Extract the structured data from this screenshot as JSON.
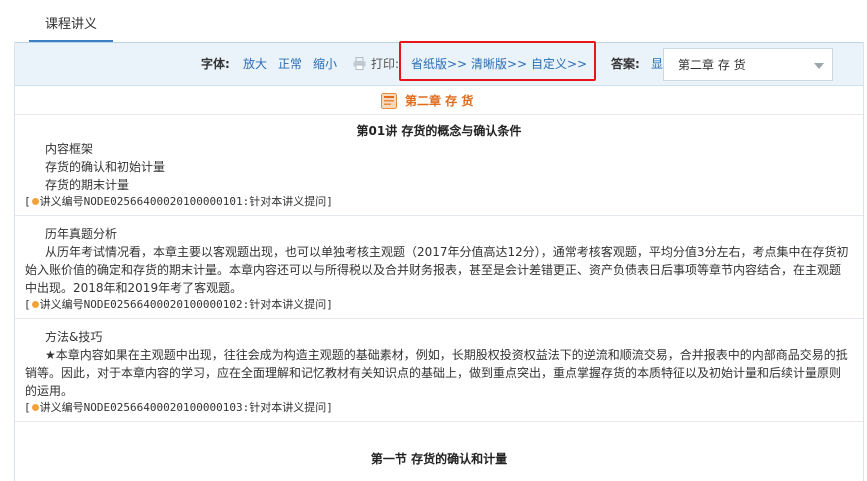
{
  "tabs": [
    {
      "label": "课程讲义"
    }
  ],
  "toolbar": {
    "font_label": "字体:",
    "font_options": [
      "放大",
      "正常",
      "缩小"
    ],
    "print_label": "打印:",
    "print_options": [
      "省纸版>>",
      "清晰版>>",
      "自定义>>"
    ],
    "answer_label": "答案:",
    "answer_option": "显",
    "chapter_select": "第二章  存  货"
  },
  "chapter_header": "第二章  存  货",
  "sections": [
    {
      "heading": "第01讲  存货的概念与确认条件",
      "lines": [
        "内容框架",
        "存货的确认和初始计量",
        "存货的期末计量"
      ],
      "ref": "讲义编号NODE02566400020100000101:针对本讲义提问"
    },
    {
      "title": "历年真题分析",
      "paragraph": "从历年考试情况看，本章主要以客观题出现，也可以单独考核主观题（2017年分值高达12分），通常考核客观题，平均分值3分左右，考点集中在存货初始入账价值的确定和存货的期末计量。本章内容还可以与所得税以及合并财务报表，甚至是会计差错更正、资产负债表日后事项等章节内容结合，在主观题中出现。2018年和2019年考了客观题。",
      "ref": "讲义编号NODE02566400020100000102:针对本讲义提问"
    },
    {
      "title": "方法&技巧",
      "paragraph": "★本章内容如果在主观题中出现，往往会成为构造主观题的基础素材，例如，长期股权投资权益法下的逆流和顺流交易，合并报表中的内部商品交易的抵销等。因此，对于本章内容的学习，应在全面理解和记忆教材有关知识点的基础上，做到重点突出，重点掌握存货的本质特征以及初始计量和后续计量原则的运用。",
      "ref": "讲义编号NODE02566400020100000103:针对本讲义提问"
    }
  ],
  "next_heading": "第一节  存货的确认和计量",
  "colors": {
    "accent": "#2a6eb3",
    "chapter": "#e06c1c",
    "highlight": "#e8161b",
    "toolbar_bg": "#eaf2fa"
  }
}
